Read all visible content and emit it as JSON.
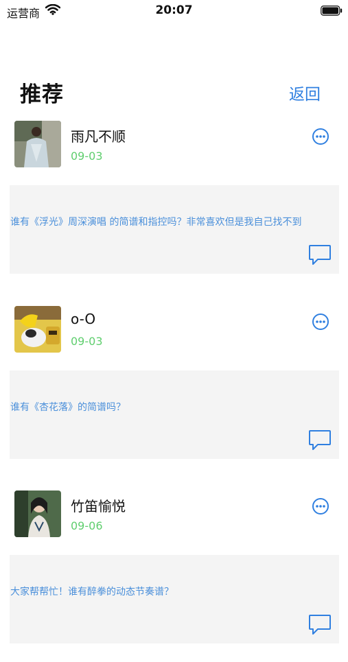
{
  "status_bar": {
    "carrier": "运营商",
    "time": "20:07"
  },
  "header": {
    "title": "推荐",
    "back_label": "返回"
  },
  "colors": {
    "accent": "#2f7fe0",
    "date": "#5fce6e",
    "post_text": "#4a8fda",
    "card_bg": "#f4f4f4"
  },
  "posts": [
    {
      "username": "雨凡不顺",
      "date": "09-03",
      "text": "谁有《浮光》周深演唱 的简谱和指控吗？非常喜欢但是我自己找不到",
      "avatar": "user-photo-avatar"
    },
    {
      "username": "o-O",
      "date": "09-03",
      "text": "谁有《杏花落》的简谱吗？",
      "avatar": "cat-cartoon-avatar"
    },
    {
      "username": "竹笛愉悦",
      "date": "09-06",
      "text": "大家帮帮忙！谁有醉拳的动态节奏谱？",
      "avatar": "portrait-avatar"
    }
  ]
}
